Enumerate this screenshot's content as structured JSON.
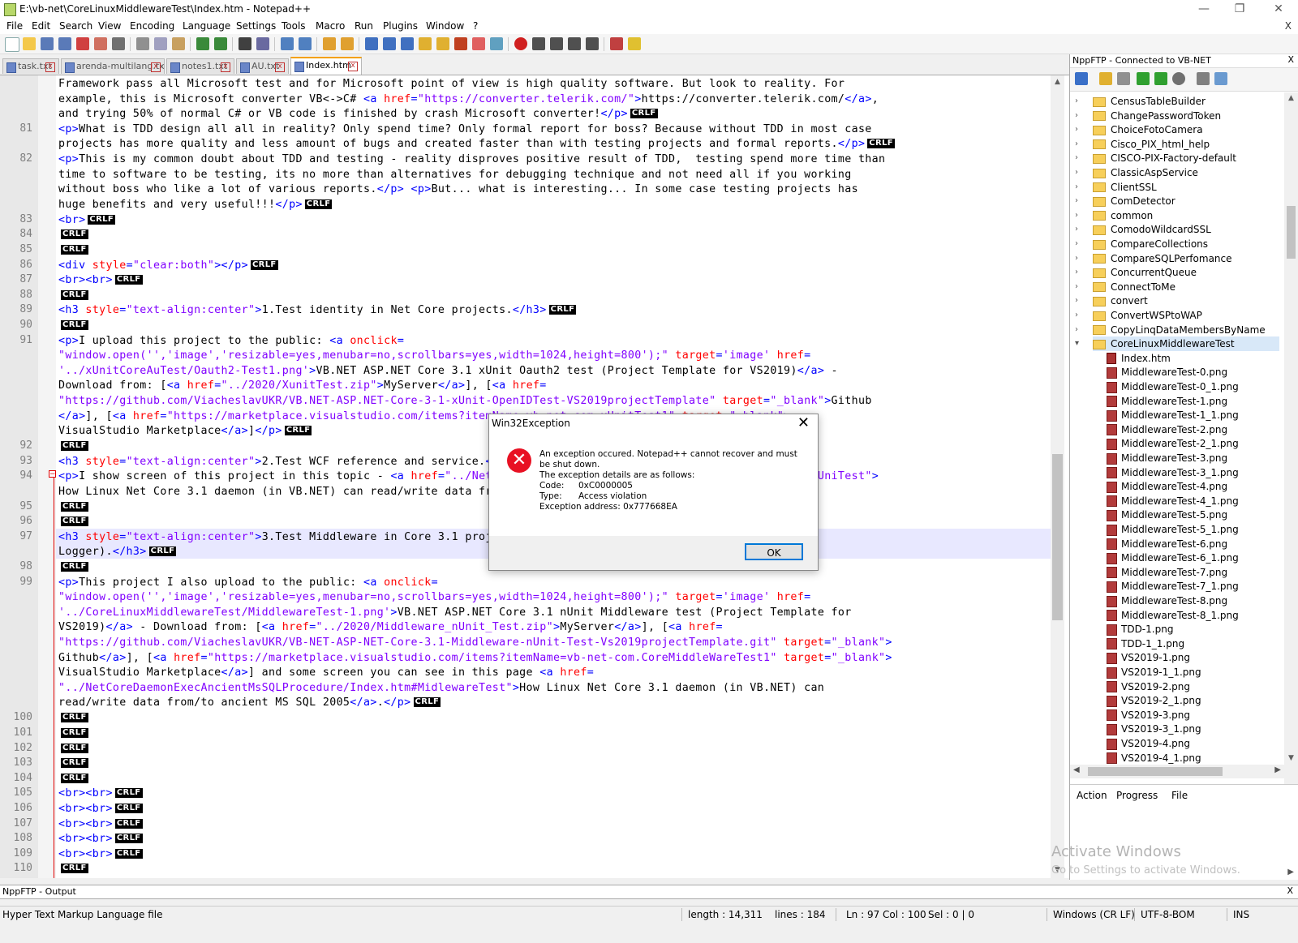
{
  "window": {
    "title": "E:\\vb-net\\CoreLinuxMiddlewareTest\\Index.htm - Notepad++",
    "minimize": "—",
    "maximize": "❐",
    "close": "✕"
  },
  "menu": {
    "items": [
      "File",
      "Edit",
      "Search",
      "View",
      "Encoding",
      "Language",
      "Settings",
      "Tools",
      "Macro",
      "Run",
      "Plugins",
      "Window",
      "?"
    ],
    "close": "X"
  },
  "tabs": [
    {
      "label": "task.txt",
      "active": false
    },
    {
      "label": "arenda-multilang.txt",
      "active": false
    },
    {
      "label": "notes1.txt",
      "active": false
    },
    {
      "label": "AU.txt",
      "active": false
    },
    {
      "label": "Index.htm",
      "active": true
    }
  ],
  "editor": {
    "line_numbers": [
      "81",
      "82",
      "83",
      "84",
      "85",
      "86",
      "87",
      "88",
      "89",
      "90",
      "91",
      "92",
      "93",
      "94",
      "95",
      "96",
      "97",
      "98",
      "99",
      "100",
      "101",
      "102",
      "103",
      "104",
      "105",
      "106",
      "107",
      "108",
      "109",
      "110"
    ],
    "eol": "CRLF",
    "fold_minus": "−"
  },
  "ftp": {
    "title": "NppFTP - Connected to VB-NET",
    "close": "X",
    "folders": [
      "CensusTableBuilder",
      "ChangePasswordToken",
      "ChoiceFotoCamera",
      "Cisco_PIX_html_help",
      "CISCO-PIX-Factory-default",
      "ClassicAspService",
      "ClientSSL",
      "ComDetector",
      "common",
      "ComodoWildcardSSL",
      "CompareCollections",
      "CompareSQLPerfomance",
      "ConcurrentQueue",
      "ConnectToMe",
      "convert",
      "ConvertWSPtoWAP",
      "CopyLinqDataMembersByName",
      "CoreLinuxMiddlewareTest"
    ],
    "files": [
      "Index.htm",
      "MiddlewareTest-0.png",
      "MiddlewareTest-0_1.png",
      "MiddlewareTest-1.png",
      "MiddlewareTest-1_1.png",
      "MiddlewareTest-2.png",
      "MiddlewareTest-2_1.png",
      "MiddlewareTest-3.png",
      "MiddlewareTest-3_1.png",
      "MiddlewareTest-4.png",
      "MiddlewareTest-4_1.png",
      "MiddlewareTest-5.png",
      "MiddlewareTest-5_1.png",
      "MiddlewareTest-6.png",
      "MiddlewareTest-6_1.png",
      "MiddlewareTest-7.png",
      "MiddlewareTest-7_1.png",
      "MiddlewareTest-8.png",
      "MiddlewareTest-8_1.png",
      "TDD-1.png",
      "TDD-1_1.png",
      "VS2019-1.png",
      "VS2019-1_1.png",
      "VS2019-2.png",
      "VS2019-2_1.png",
      "VS2019-3.png",
      "VS2019-3_1.png",
      "VS2019-4.png",
      "VS2019-4_1.png"
    ],
    "queue_tabs": [
      "Action",
      "Progress",
      "File"
    ]
  },
  "output": {
    "title": "NppFTP - Output",
    "close": "X"
  },
  "status": {
    "file_type": "Hyper Text Markup Language file",
    "length": "length : 14,311",
    "lines": "lines : 184",
    "ln": "Ln : 97",
    "col": "Col : 100",
    "sel": "Sel : 0 | 0",
    "eol": "Windows (CR LF)",
    "encoding": "UTF-8-BOM",
    "mode": "INS"
  },
  "watermark": {
    "line1": "Activate Windows",
    "line2": "Go to Settings to activate Windows."
  },
  "dialog": {
    "title": "Win32Exception",
    "close": "✕",
    "message_line1": "An exception occured. Notepad++ cannot recover and must",
    "message_line2": "be shut down.",
    "message_line3": "The exception details are as follows:",
    "code_label": "Code:",
    "code_value": "0xC0000005",
    "type_label": "Type:",
    "type_value": "Access violation",
    "address": "Exception address: 0x777668EA",
    "ok": "OK"
  },
  "colors": {
    "tag": "#0000ff",
    "attribute": "#ff0000",
    "value": "#8000ff",
    "error": "#e81123",
    "current_line": "#e8e8ff"
  }
}
